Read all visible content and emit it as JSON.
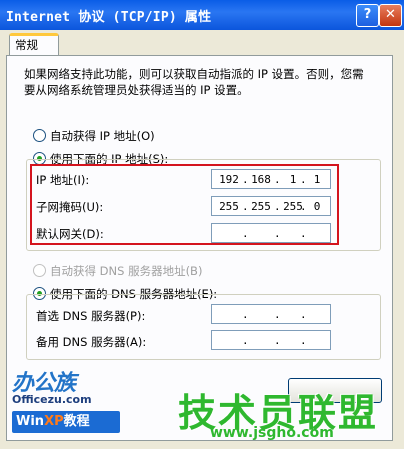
{
  "window": {
    "title": "Internet 协议 (TCP/IP) 属性",
    "help_glyph": "?",
    "close_glyph": "✕"
  },
  "tabs": [
    {
      "label": "常规"
    }
  ],
  "description": "如果网络支持此功能，则可以获取自动指派的 IP 设置。否则，您需要从网络系统管理员处获得适当的 IP 设置。",
  "ip_mode": {
    "auto_label": "自动获得 IP 地址(O)",
    "manual_label": "使用下面的 IP 地址(S):",
    "selected": "manual"
  },
  "ip_fields": {
    "ip_label": "IP 地址(I):",
    "ip_value": [
      "192",
      "168",
      "1",
      "1"
    ],
    "mask_label": "子网掩码(U):",
    "mask_value": [
      "255",
      "255",
      "255",
      "0"
    ],
    "gateway_label": "默认网关(D):",
    "gateway_value": [
      "",
      "",
      "",
      ""
    ]
  },
  "dns_mode": {
    "auto_label": "自动获得 DNS 服务器地址(B)",
    "manual_label": "使用下面的 DNS 服务器地址(E):",
    "selected": "manual"
  },
  "dns_fields": {
    "preferred_label": "首选 DNS 服务器(P):",
    "alternate_label": "备用 DNS 服务器(A):"
  },
  "ip_separator": ".",
  "watermarks": {
    "brand": "办公族",
    "site": "Officezu.com",
    "win_prefix": "Win",
    "win_xp": "XP",
    "win_suffix": "教程",
    "big_text": "技术员联盟",
    "url": "www.jsgho.com"
  },
  "colors": {
    "title_bar": "#0b55dc",
    "highlight_box": "#d4141e",
    "watermark_green": "#2fb82f"
  }
}
